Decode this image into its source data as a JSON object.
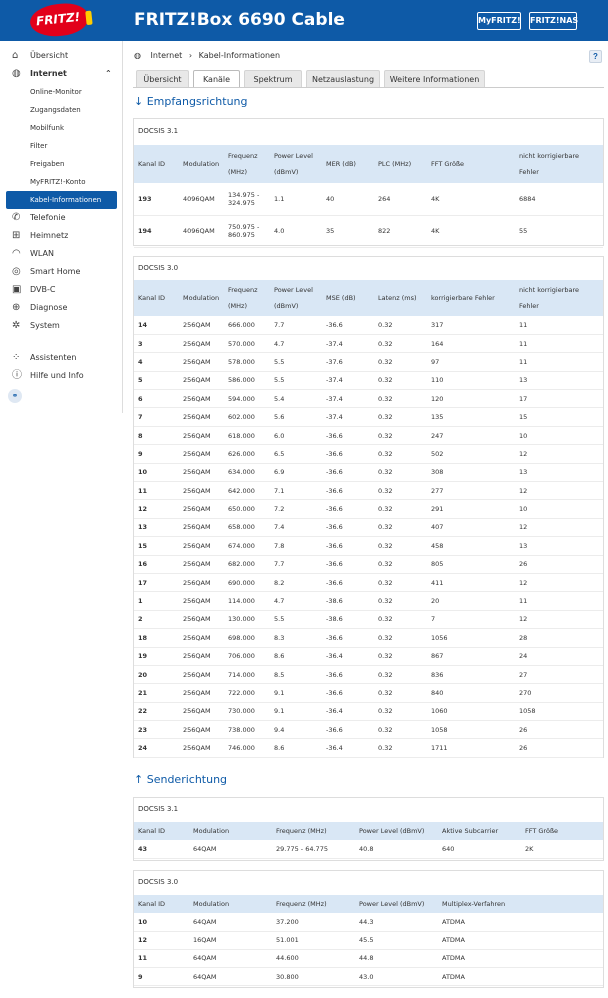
{
  "header": {
    "logo_text": "FRITZ!",
    "title": "FRITZ!Box 6690 Cable",
    "myfritz_label": "MyFRITZ!",
    "fritznas_label": "FRITZ!NAS"
  },
  "sidebar": {
    "items": [
      {
        "label": "Übersicht",
        "icon": "home-icon"
      },
      {
        "label": "Internet",
        "icon": "globe-icon"
      },
      {
        "label": "Online-Monitor"
      },
      {
        "label": "Zugangsdaten"
      },
      {
        "label": "Mobilfunk"
      },
      {
        "label": "Filter"
      },
      {
        "label": "Freigaben"
      },
      {
        "label": "MyFRITZ!-Konto"
      },
      {
        "label": "Kabel-Informationen"
      },
      {
        "label": "Telefonie",
        "icon": "phone-icon"
      },
      {
        "label": "Heimnetz",
        "icon": "network-icon"
      },
      {
        "label": "WLAN",
        "icon": "wifi-icon"
      },
      {
        "label": "Smart Home",
        "icon": "smarthome-icon"
      },
      {
        "label": "DVB-C",
        "icon": "tv-icon"
      },
      {
        "label": "Diagnose",
        "icon": "diagnose-icon"
      },
      {
        "label": "System",
        "icon": "gear-icon"
      },
      {
        "label": "Assistenten",
        "icon": "assistant-icon"
      },
      {
        "label": "Hilfe und Info",
        "icon": "help-icon"
      }
    ]
  },
  "breadcrumb": {
    "part1": "Internet",
    "sep": "›",
    "part2": "Kabel-Informationen"
  },
  "help_label": "?",
  "tabs": [
    "Übersicht",
    "Kanäle",
    "Spektrum",
    "Netzauslastung",
    "Weitere Informationen"
  ],
  "downstream": {
    "heading": "Empfangsrichtung",
    "docsis31": {
      "title": "DOCSIS 3.1",
      "headers": [
        "Kanal ID",
        "Modulation",
        "Frequenz (MHz)",
        "Power Level (dBmV)",
        "MER (dB)",
        "PLC (MHz)",
        "FFT Größe",
        "nicht korrigierbare Fehler"
      ],
      "rows": [
        [
          "193",
          "4096QAM",
          "134.975 - 324.975",
          "1.1",
          "40",
          "264",
          "4K",
          "6884"
        ],
        [
          "194",
          "4096QAM",
          "750.975 - 860.975",
          "4.0",
          "35",
          "822",
          "4K",
          "55"
        ]
      ]
    },
    "docsis30": {
      "title": "DOCSIS 3.0",
      "headers": [
        "Kanal ID",
        "Modulation",
        "Frequenz (MHz)",
        "Power Level (dBmV)",
        "MSE (dB)",
        "Latenz (ms)",
        "korrigierbare Fehler",
        "nicht korrigierbare Fehler"
      ],
      "rows": [
        [
          "14",
          "256QAM",
          "666.000",
          "7.7",
          "-36.6",
          "0.32",
          "317",
          "11"
        ],
        [
          "3",
          "256QAM",
          "570.000",
          "4.7",
          "-37.4",
          "0.32",
          "164",
          "11"
        ],
        [
          "4",
          "256QAM",
          "578.000",
          "5.5",
          "-37.6",
          "0.32",
          "97",
          "11"
        ],
        [
          "5",
          "256QAM",
          "586.000",
          "5.5",
          "-37.4",
          "0.32",
          "110",
          "13"
        ],
        [
          "6",
          "256QAM",
          "594.000",
          "5.4",
          "-37.4",
          "0.32",
          "120",
          "17"
        ],
        [
          "7",
          "256QAM",
          "602.000",
          "5.6",
          "-37.4",
          "0.32",
          "135",
          "15"
        ],
        [
          "8",
          "256QAM",
          "618.000",
          "6.0",
          "-36.6",
          "0.32",
          "247",
          "10"
        ],
        [
          "9",
          "256QAM",
          "626.000",
          "6.5",
          "-36.6",
          "0.32",
          "502",
          "12"
        ],
        [
          "10",
          "256QAM",
          "634.000",
          "6.9",
          "-36.6",
          "0.32",
          "308",
          "13"
        ],
        [
          "11",
          "256QAM",
          "642.000",
          "7.1",
          "-36.6",
          "0.32",
          "277",
          "12"
        ],
        [
          "12",
          "256QAM",
          "650.000",
          "7.2",
          "-36.6",
          "0.32",
          "291",
          "10"
        ],
        [
          "13",
          "256QAM",
          "658.000",
          "7.4",
          "-36.6",
          "0.32",
          "407",
          "12"
        ],
        [
          "15",
          "256QAM",
          "674.000",
          "7.8",
          "-36.6",
          "0.32",
          "458",
          "13"
        ],
        [
          "16",
          "256QAM",
          "682.000",
          "7.7",
          "-36.6",
          "0.32",
          "805",
          "26"
        ],
        [
          "17",
          "256QAM",
          "690.000",
          "8.2",
          "-36.6",
          "0.32",
          "411",
          "12"
        ],
        [
          "1",
          "256QAM",
          "114.000",
          "4.7",
          "-38.6",
          "0.32",
          "20",
          "11"
        ],
        [
          "2",
          "256QAM",
          "130.000",
          "5.5",
          "-38.6",
          "0.32",
          "7",
          "12"
        ],
        [
          "18",
          "256QAM",
          "698.000",
          "8.3",
          "-36.6",
          "0.32",
          "1056",
          "28"
        ],
        [
          "19",
          "256QAM",
          "706.000",
          "8.6",
          "-36.4",
          "0.32",
          "867",
          "24"
        ],
        [
          "20",
          "256QAM",
          "714.000",
          "8.5",
          "-36.6",
          "0.32",
          "836",
          "27"
        ],
        [
          "21",
          "256QAM",
          "722.000",
          "9.1",
          "-36.6",
          "0.32",
          "840",
          "270"
        ],
        [
          "22",
          "256QAM",
          "730.000",
          "9.1",
          "-36.4",
          "0.32",
          "1060",
          "1058"
        ],
        [
          "23",
          "256QAM",
          "738.000",
          "9.4",
          "-36.6",
          "0.32",
          "1058",
          "26"
        ],
        [
          "24",
          "256QAM",
          "746.000",
          "8.6",
          "-36.4",
          "0.32",
          "1711",
          "26"
        ]
      ]
    }
  },
  "upstream": {
    "heading": "Senderichtung",
    "docsis31": {
      "title": "DOCSIS 3.1",
      "headers": [
        "Kanal ID",
        "Modulation",
        "Frequenz (MHz)",
        "Power Level (dBmV)",
        "Aktive Subcarrier",
        "FFT Größe"
      ],
      "rows": [
        [
          "43",
          "64QAM",
          "29.775 - 64.775",
          "40.8",
          "640",
          "2K"
        ]
      ]
    },
    "docsis30": {
      "title": "DOCSIS 3.0",
      "headers": [
        "Kanal ID",
        "Modulation",
        "Frequenz (MHz)",
        "Power Level (dBmV)",
        "Multiplex-Verfahren"
      ],
      "rows": [
        [
          "10",
          "64QAM",
          "37.200",
          "44.3",
          "ATDMA"
        ],
        [
          "12",
          "16QAM",
          "51.001",
          "45.5",
          "ATDMA"
        ],
        [
          "11",
          "64QAM",
          "44.600",
          "44.8",
          "ATDMA"
        ],
        [
          "9",
          "64QAM",
          "30.800",
          "43.0",
          "ATDMA"
        ]
      ]
    }
  },
  "colors": {
    "brand": "#0e5aa7",
    "header_row": "#d9e7f5",
    "logo_red": "#e2001a"
  }
}
